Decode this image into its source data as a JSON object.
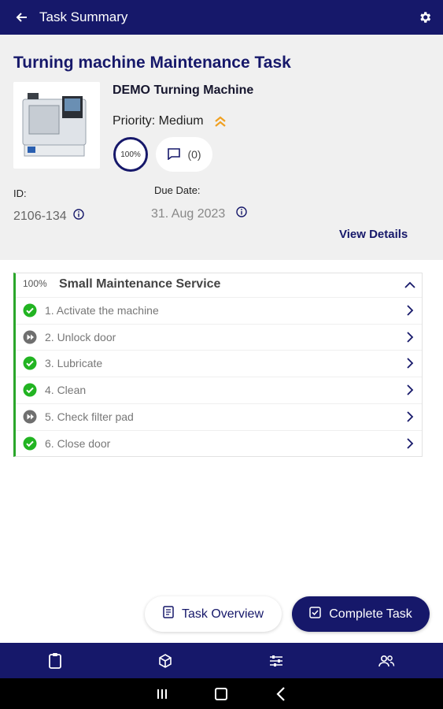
{
  "header": {
    "title": "Task Summary",
    "back_icon": "arrow-left-icon",
    "settings_icon": "gear-icon",
    "bg_color": "#16186a"
  },
  "task": {
    "title": "Turning machine Maintenance Task",
    "machine_name": "DEMO Turning Machine",
    "priority_label": "Priority: Medium",
    "priority_icon": "double-chevron-up-icon",
    "priority_color": "#f0a020",
    "progress": "100%",
    "comments": "(0)",
    "id_label": "ID:",
    "id_value": "2106-134",
    "due_label": "Due Date:",
    "due_value": "31. Aug 2023",
    "view_details": "View Details"
  },
  "section": {
    "progress": "100%",
    "title": "Small Maintenance Service",
    "accent_color": "#2aa62a",
    "steps": [
      {
        "label": "1. Activate the machine",
        "status": "done"
      },
      {
        "label": "2. Unlock door",
        "status": "skipped"
      },
      {
        "label": "3. Lubricate",
        "status": "done"
      },
      {
        "label": "4. Clean",
        "status": "done"
      },
      {
        "label": "5. Check filter pad",
        "status": "skipped"
      },
      {
        "label": "6. Close door",
        "status": "done"
      }
    ]
  },
  "actions": {
    "overview_label": "Task Overview",
    "complete_label": "Complete Task"
  },
  "bottom_nav": [
    "clipboard-icon",
    "cube-icon",
    "sliders-icon",
    "users-icon"
  ],
  "system_nav": [
    "recents-icon",
    "home-icon",
    "back-icon"
  ]
}
